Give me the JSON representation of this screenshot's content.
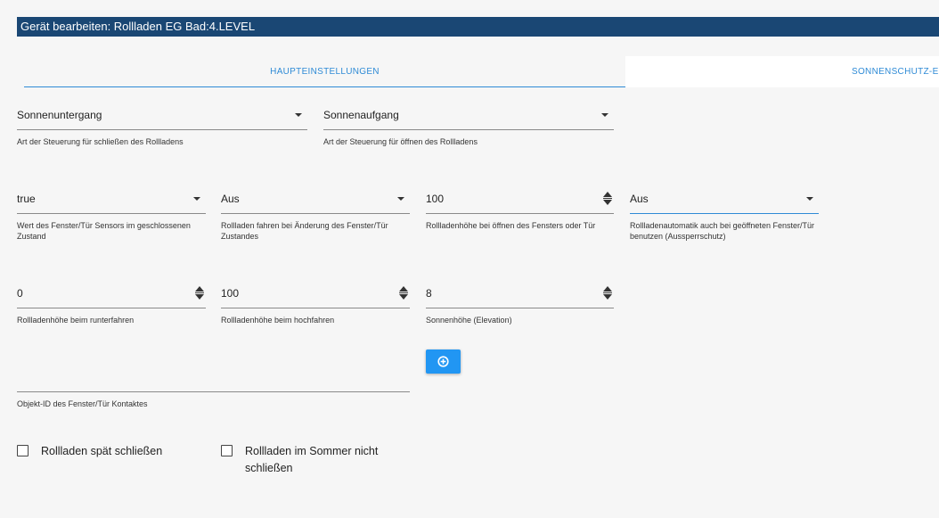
{
  "window": {
    "title": "Gerät bearbeiten: Rollladen EG Bad:4.LEVEL"
  },
  "tabs": [
    {
      "label": "HAUPTEINSTELLUNGEN",
      "active": true
    },
    {
      "label": "SONNENSCHUTZ-EIN",
      "active": false
    }
  ],
  "fields": {
    "close_mode": {
      "value": "Sonnenuntergang",
      "help": "Art der Steuerung für schließen des Rollladens"
    },
    "open_mode": {
      "value": "Sonnenaufgang",
      "help": "Art der Steuerung für öffnen des Rollladens"
    },
    "sensor_value": {
      "value": "true",
      "help": "Wert des Fenster/Tür Sensors im geschlossenen Zustand"
    },
    "move_on_change": {
      "value": "Aus",
      "help": "Rollladen fahren bei Änderung des Fenster/Tür Zustandes"
    },
    "open_height": {
      "value": "100",
      "help": "Rollladenhöhe bei öffnen des Fensters oder Tür"
    },
    "lockout": {
      "value": "Aus",
      "help": "Rollladenautomatik auch bei geöffneten Fenster/Tür benutzen (Aussperrschutz)"
    },
    "down_height": {
      "value": "0",
      "help": "Rollladenhöhe beim runterfahren"
    },
    "up_height": {
      "value": "100",
      "help": "Rollladenhöhe beim hochfahren"
    },
    "elevation": {
      "value": "8",
      "help": "Sonnenhöhe (Elevation)"
    },
    "contact_id": {
      "value": "",
      "help": "Objekt-ID des Fenster/Tür Kontaktes"
    }
  },
  "checkboxes": [
    {
      "label": "Rollladen spät schließen",
      "checked": false
    },
    {
      "label": "Rollladen im Sommer nicht schließen",
      "checked": false
    }
  ],
  "colors": {
    "titlebar": "#1a4774",
    "accent": "#2f8bd6",
    "button": "#2196f3"
  }
}
